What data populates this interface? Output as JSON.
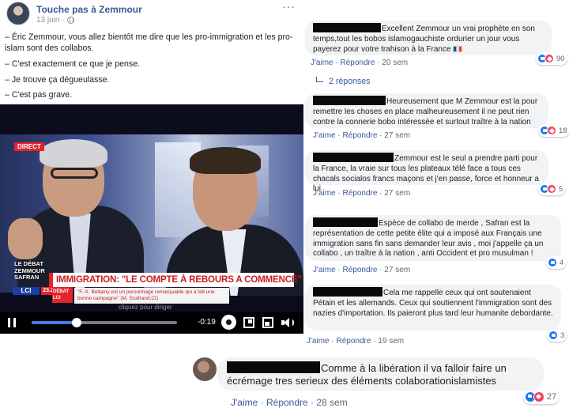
{
  "post": {
    "page_name": "Touche pas à Zemmour",
    "date": "13 juin",
    "separator": "·",
    "more": "···",
    "lines": [
      "– Éric Zemmour, vous allez bientôt me dire que les pro-immigration et les pro-islam sont des collabos.",
      "– C'est exactement ce que je pense.",
      "– Je trouve ça dégueulasse.",
      "– C'est pas grave."
    ]
  },
  "video": {
    "direct": "DIRECT",
    "show_title": "LE DÉBAT\nZEMMOUR\nSAFRAN",
    "banner": "IMMIGRATION: \"LE COMPTE À REBOURS A COMMENCÉ\"",
    "channel": "LCI",
    "clock": "23.27",
    "debat_tag": "DÉBAT LCI",
    "quote": "\"F.-X. Bellamy est un personnage remarquable qui a fait une bonne campagne\" (M. Szafran/LCI)",
    "watermark": "cliquez pour diriger",
    "time_remaining": "-0:19",
    "progress": 0.31
  },
  "comments": [
    {
      "text": "Excellent Zemmour un vrai prophète en son temps,tout les bobos islamogauchiste ordurier un jour vous payerez pour votre trahison à la France",
      "like": "J'aime",
      "reply": "Répondre",
      "time": "20 sem",
      "reactions": "90"
    },
    {
      "text": "Heureusement que M Zemmour est la pour remettre les choses en place malheureusement il ne peut rien contre la connerie bobo intéressée et surtout traître à la nation",
      "like": "J'aime",
      "reply": "Répondre",
      "time": "27 sem",
      "reactions": "18"
    },
    {
      "text": "Zemmour est le seul a prendre parti pour la France, la vraie sur tous les plateaux télé face a tous ces chacals socialos francs maçons et j'en passe, force et honneur a lui",
      "like": "J'aime",
      "reply": "Répondre",
      "time": "27 sem",
      "reactions": "5"
    },
    {
      "text": "Espèce de collabo de merde , Safran est la représentation de cette petite élite qui a imposé aux Français une immigration sans fin sans demander leur avis , moi j'appelle ça un collabo , un traître à la nation , anti Occident et pro musulman !",
      "like": "J'aime",
      "reply": "Répondre",
      "time": "27 sem",
      "reactions": "4"
    },
    {
      "text": "Cela me rappelle ceux qui ont soutenaient Pétain et les allemands. Ceux qui soutiennent l'immigration sont des nazies d'importation. Ils paieront plus tard leur humanite debordante.",
      "like": "J'aime",
      "reply": "Répondre",
      "time": "19 sem",
      "reactions": "3"
    },
    {
      "text": "Comme à la libération il va falloir faire un écrémage tres serieux des éléments colaborationislamistes",
      "like": "J'aime",
      "reply": "Répondre",
      "time": "28 sem",
      "reactions": "27"
    }
  ],
  "replies_link": "2 réponses"
}
